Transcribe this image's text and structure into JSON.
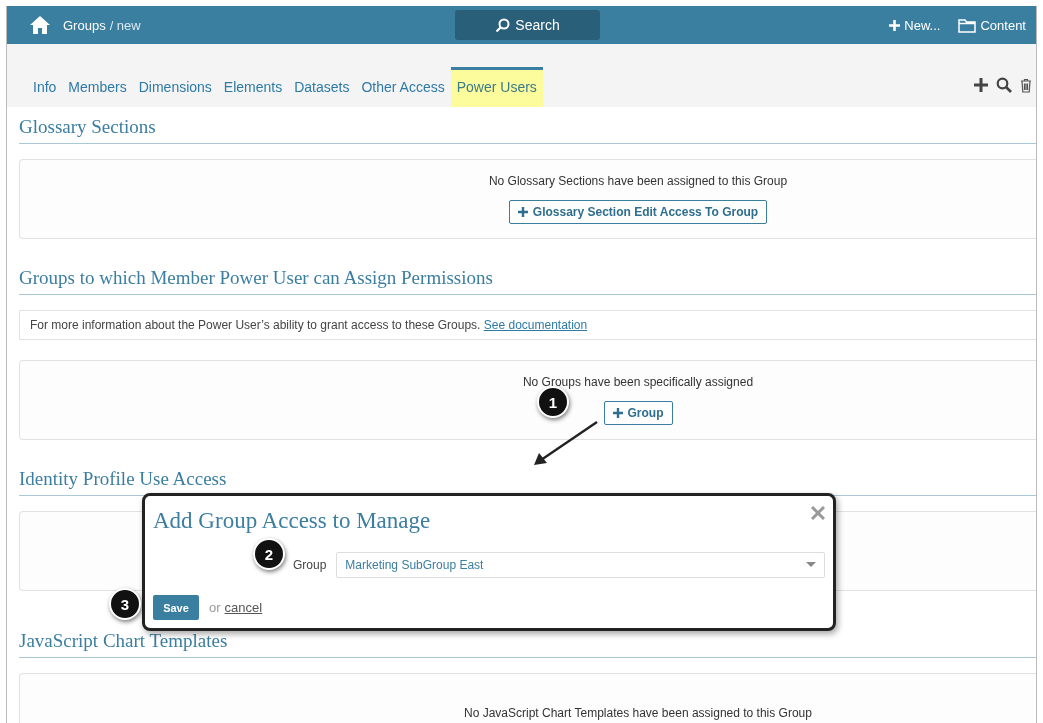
{
  "header": {
    "breadcrumb": "Groups",
    "breadcrumb_suffix": "/ new",
    "search": "Search",
    "new": "New...",
    "content": "Content"
  },
  "tabs": [
    {
      "label": "Info",
      "selected": false
    },
    {
      "label": "Members",
      "selected": false
    },
    {
      "label": "Dimensions",
      "selected": false
    },
    {
      "label": "Elements",
      "selected": false
    },
    {
      "label": "Datasets",
      "selected": false
    },
    {
      "label": "Other Access",
      "selected": false
    },
    {
      "label": "Power Users",
      "selected": true
    }
  ],
  "sections": [
    {
      "title": "Glossary Sections",
      "panels": [
        {
          "kind": "empty",
          "message": "No Glossary Sections have been assigned to this Group",
          "button": "Glossary Section Edit Access To Group"
        }
      ]
    },
    {
      "title": "Groups to which Member Power User can Assign Permissions",
      "panels": [
        {
          "kind": "info",
          "text": "For more information about the Power User’s ability to grant access to these Groups.",
          "link": "See documentation"
        },
        {
          "kind": "empty",
          "message": "No Groups have been specifically assigned",
          "button": "Group"
        }
      ]
    },
    {
      "title": "Identity Profile Use Access",
      "panels": [
        {
          "kind": "empty"
        }
      ]
    },
    {
      "title": "JavaScript Chart Templates",
      "panels": [
        {
          "kind": "empty",
          "message": "No JavaScript Chart Templates have been assigned to this Group"
        }
      ]
    }
  ],
  "dialog": {
    "title": "Add Group Access to Manage",
    "field_label": "Group",
    "value": "Marketing SubGroup East",
    "save": "Save",
    "or": "or",
    "cancel": "cancel"
  },
  "callouts": [
    "1",
    "2",
    "3"
  ]
}
